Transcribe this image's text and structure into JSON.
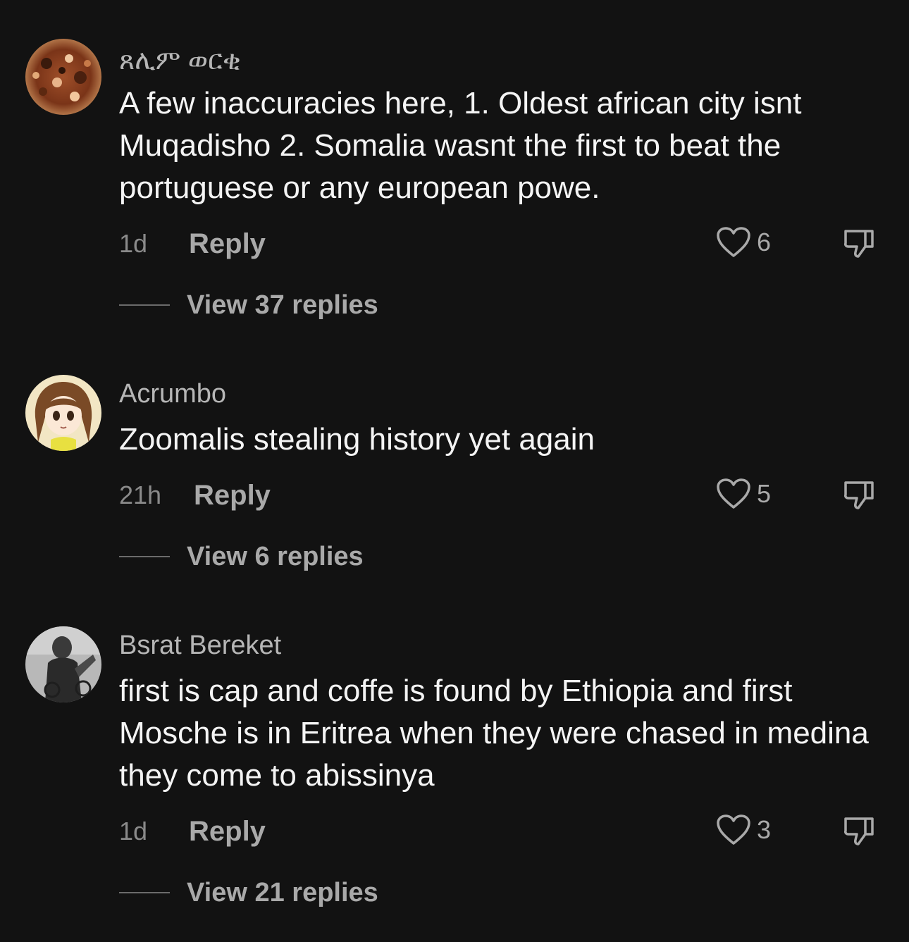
{
  "comments": [
    {
      "username": "ጸሊም ወርቂ",
      "avatar_icon": "food-photo-avatar",
      "text": "A few inaccuracies here, 1. Oldest african city isnt Muqadisho 2. Somalia wasnt the first to beat the portuguese or any european powe.",
      "time": "1d",
      "reply_label": "Reply",
      "like_count": "6",
      "view_replies": "View 37 replies"
    },
    {
      "username": "Acrumbo",
      "avatar_icon": "anime-girl-avatar",
      "text": "Zoomalis stealing history yet again",
      "time": "21h",
      "reply_label": "Reply",
      "like_count": "5",
      "view_replies": "View 6 replies"
    },
    {
      "username": "Bsrat Bereket",
      "avatar_icon": "grayscale-photo-avatar",
      "text": "first is cap and coffe is found by Ethiopia and first Mosche is in Eritrea when they were chased in medina they come to abissinya",
      "time": "1d",
      "reply_label": "Reply",
      "like_count": "3",
      "view_replies": "View 21 replies"
    }
  ],
  "icons": {
    "like": "heart-outline-icon",
    "dislike": "thumbs-down-outline-icon"
  },
  "colors": {
    "background": "#121212",
    "username": "#b6b6b6",
    "body_text": "#f4f4f4",
    "secondary": "#a9a9a9"
  }
}
